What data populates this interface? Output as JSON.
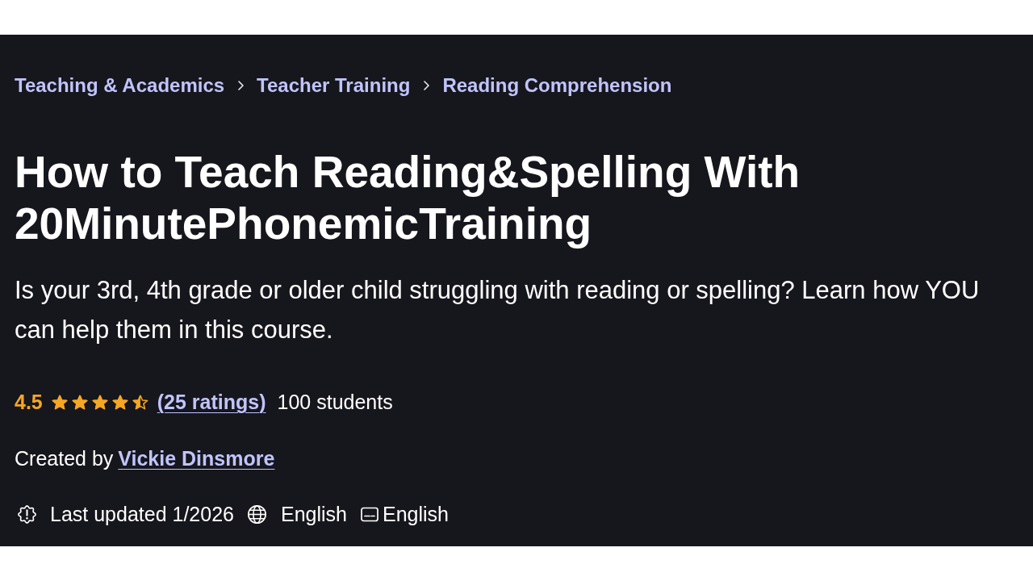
{
  "breadcrumb": [
    {
      "label": "Teaching & Academics"
    },
    {
      "label": "Teacher Training"
    },
    {
      "label": "Reading Comprehension"
    }
  ],
  "title": "How to Teach Reading&Spelling With 20MinutePhonemicTraining",
  "headline": "Is your 3rd, 4th grade or older child struggling with reading or spelling? Learn how YOU can help them in this course.",
  "rating": {
    "score": "4.5",
    "stars": 4.5,
    "ratings_link": "(25 ratings)",
    "students": "100 students"
  },
  "created_by": {
    "label": "Created by",
    "author": "Vickie Dinsmore"
  },
  "meta": [
    {
      "kind": "updated",
      "text": "Last updated 1/2026"
    },
    {
      "kind": "language",
      "text": "English"
    },
    {
      "kind": "captions",
      "text": "English"
    }
  ]
}
